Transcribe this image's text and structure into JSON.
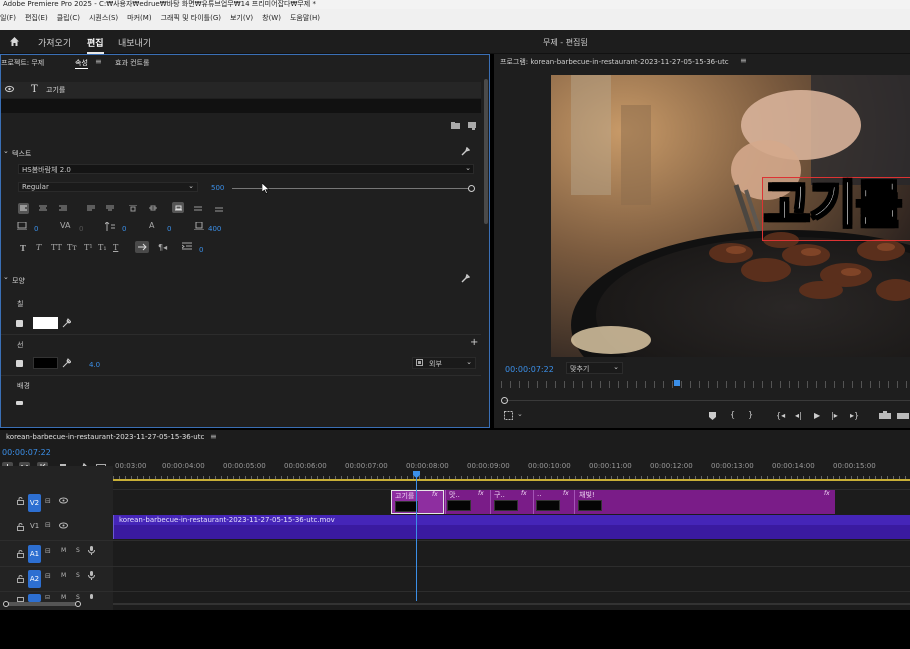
{
  "window": {
    "title": "Adobe Premiere Pro 2025 - C:₩사용자₩edrue₩바탕 화면₩유튜브업무₩14 프리미어잡다₩무제 *"
  },
  "menu": [
    "일(F)",
    "편집(E)",
    "클립(C)",
    "시퀀스(S)",
    "마커(M)",
    "그래픽 및 타이틀(G)",
    "보기(V)",
    "창(W)",
    "도움말(H)"
  ],
  "workspace": {
    "tabs": [
      "가져오기",
      "편집",
      "내보내기"
    ],
    "active": "편집",
    "project_title": "무제 - 편집됨"
  },
  "essential_graphics": {
    "panel_tabs": [
      "프로젝트: 무제"
    ],
    "subtabs": [
      "속성",
      "효과 컨트롤"
    ],
    "layer_name": "고기를",
    "text_section": "텍스트",
    "font_name": "HS봄바람체 2.0",
    "font_style": "Regular",
    "font_size": "500",
    "tracking": "0",
    "kerning": "0",
    "leading": "0",
    "baseline": "0",
    "tsume": "400",
    "indent": "0",
    "appearance_section": "모양",
    "fill_label": "칠",
    "fill_color": "#ffffff",
    "stroke_label": "선",
    "stroke_color": "#000000",
    "stroke_width": "4.0",
    "stroke_position": "외부",
    "background_label": "배경"
  },
  "program_monitor": {
    "tab": "프로그램: korean-barbecue-in-restaurant-2023-11-27-05-15-36-utc",
    "timecode": "00:00:07:22",
    "fit": "맞추기",
    "overlay_text": "고기를"
  },
  "timeline": {
    "sequence_name": "korean-barbecue-in-restaurant-2023-11-27-05-15-36-utc",
    "timecode": "00:00:07:22",
    "ruler": [
      "00:03:00",
      "00:00:04:00",
      "00:00:05:00",
      "00:00:06:00",
      "00:00:07:00",
      "00:00:08:00",
      "00:00:09:00",
      "00:00:10:00",
      "00:00:11:00",
      "00:00:12:00",
      "00:00:13:00",
      "00:00:14:00",
      "00:00:15:00"
    ],
    "tracks": [
      "V2",
      "V1",
      "A1",
      "A2",
      "A3"
    ],
    "v2_clips": [
      "고기를",
      "맛..",
      "구..",
      "..",
      "채빛!"
    ],
    "v1_clip": "korean-barbecue-in-restaurant-2023-11-27-05-15-36-utc.mov",
    "track_buttons": [
      "M",
      "S"
    ]
  },
  "colors": {
    "accent": "#2d6fd1",
    "clip_purple": "#7a1c88",
    "video_track": "#3a1aa0"
  }
}
